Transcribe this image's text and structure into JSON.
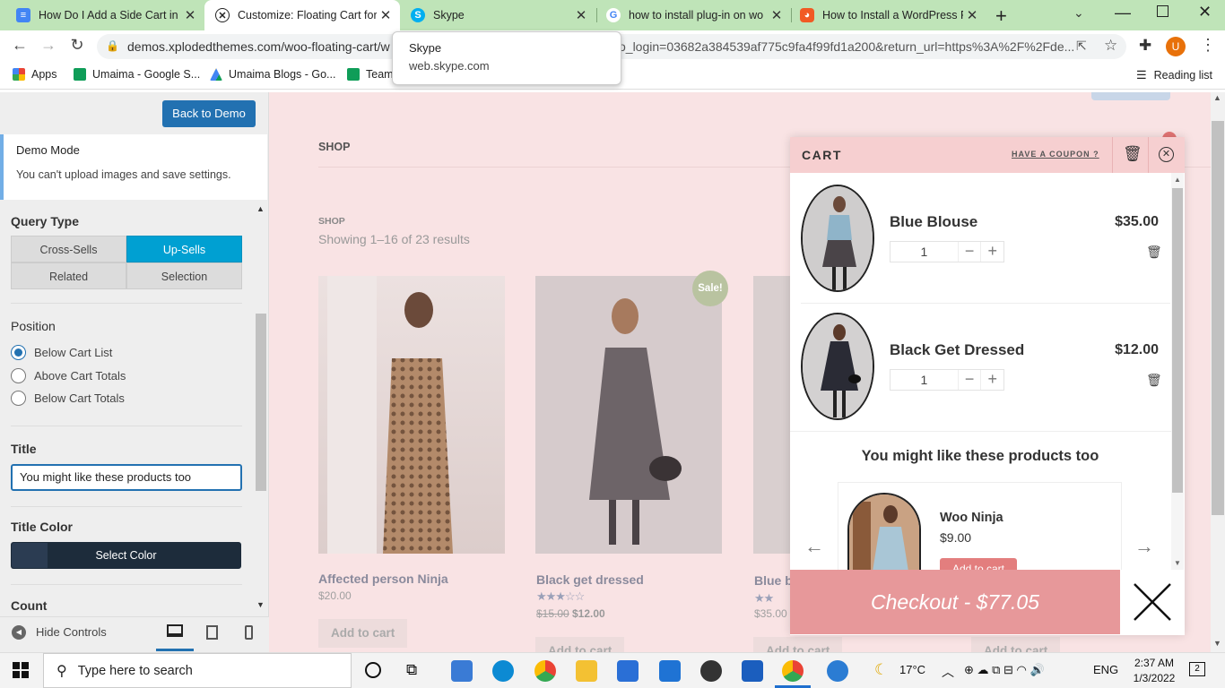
{
  "browser": {
    "tabs": [
      {
        "title": "How Do I Add a Side Cart in W",
        "icon": "docs-icon"
      },
      {
        "title": "Customize: Floating Cart for W",
        "icon": "xplodedthemes-icon",
        "active": true
      },
      {
        "title": "Skype",
        "icon": "skype-icon"
      },
      {
        "title": "how to install plug-in on wo",
        "icon": "google-icon"
      },
      {
        "title": "How to Install a WordPress P",
        "icon": "wpbeginner-icon"
      }
    ],
    "url_main": "demos.xplodedthemes.com/woo-floating-cart/w",
    "url_tail": "o_login=03682a384539af775c9fa4f99fd1a200&return_url=https%3A%2F%2Fde...",
    "avatar_letter": "U",
    "bookmarks": [
      "Apps",
      "Umaima - Google S...",
      "Umaima Blogs - Go...",
      "Team"
    ],
    "reading_list": "Reading list",
    "tooltip": {
      "title": "Skype",
      "subtitle": "web.skype.com"
    }
  },
  "panel": {
    "back_button": "Back to Demo",
    "demo_title": "Demo Mode",
    "demo_text": "You can't upload images and save settings.",
    "query_type_label": "Query Type",
    "query_types": [
      "Cross-Sells",
      "Up-Sells",
      "Related",
      "Selection"
    ],
    "selected_query_type": "Up-Sells",
    "position_label": "Position",
    "positions": [
      "Below Cart List",
      "Above Cart Totals",
      "Below Cart Totals"
    ],
    "selected_position": "Below Cart List",
    "title_label": "Title",
    "title_value": "You might like these products too",
    "title_color_label": "Title Color",
    "select_color": "Select Color",
    "count_label": "Count",
    "hide_controls": "Hide Controls"
  },
  "page": {
    "nav_item": "SHOP",
    "breadcrumb": "SHOP",
    "results": "Showing 1–16 of 23 results",
    "sale_badge": "Sale!",
    "products": [
      {
        "name": "Affected person Ninja",
        "price": "$20.00",
        "button": "Add to cart"
      },
      {
        "name": "Black get dressed",
        "old_price": "$15.00",
        "price": "$12.00",
        "rating": 3,
        "button": "Add to cart"
      },
      {
        "name": "Blue b",
        "price": "$35.00",
        "rating": 5,
        "button": "Add to cart"
      },
      {
        "name": "",
        "price": "",
        "button": "Add to cart"
      }
    ]
  },
  "cart": {
    "title": "CART",
    "coupon": "HAVE A COUPON ?",
    "items": [
      {
        "name": "Blue Blouse",
        "price": "$35.00",
        "qty": "1"
      },
      {
        "name": "Black Get Dressed",
        "price": "$12.00",
        "qty": "1"
      }
    ],
    "upsell_title": "You might like these products too",
    "upsell_item": {
      "name": "Woo Ninja",
      "price": "$9.00",
      "button": "Add to cart"
    },
    "checkout": "Checkout - $77.05"
  },
  "taskbar": {
    "search_placeholder": "Type here to search",
    "temperature": "17°C",
    "language": "ENG",
    "time": "2:37 AM",
    "date": "1/3/2022",
    "notifications": "2"
  }
}
